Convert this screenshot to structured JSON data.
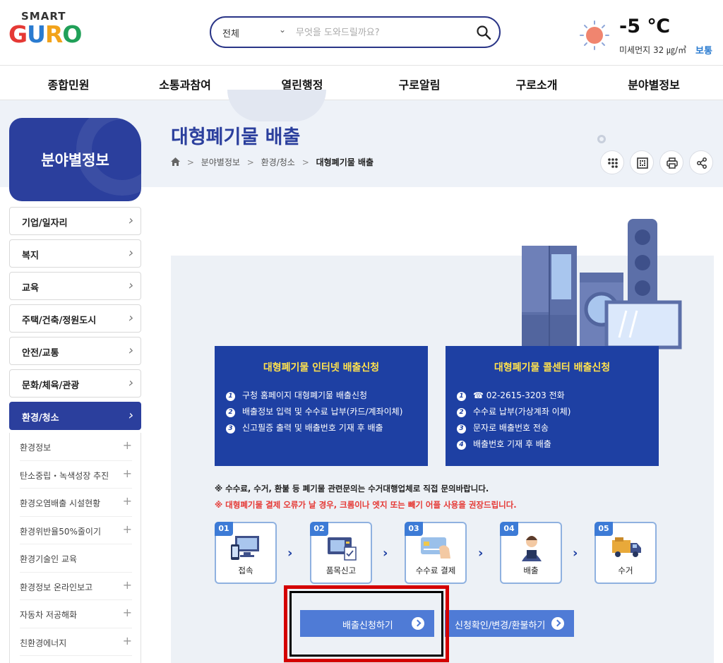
{
  "header": {
    "logo_top": "SMART",
    "logo_bottom": "GURO",
    "search_scope": "전체",
    "search_placeholder": "무엇을 도와드릴까요?",
    "temperature": "-5 ℃",
    "dust_text": "미세먼지 32 ㎍/㎥",
    "dust_status": "보통"
  },
  "gnb": [
    "종합민원",
    "소통과참여",
    "열린행정",
    "구로알림",
    "구로소개",
    "분야별정보"
  ],
  "sidebar": {
    "title": "분야별정보",
    "items": [
      {
        "label": "기업/일자리"
      },
      {
        "label": "복지"
      },
      {
        "label": "교육"
      },
      {
        "label": "주택/건축/정원도시"
      },
      {
        "label": "안전/교통"
      },
      {
        "label": "문화/체육/관광"
      },
      {
        "label": "환경/청소"
      }
    ],
    "subitems": [
      {
        "label": "환경정보",
        "plus": "+"
      },
      {
        "label": "탄소중립・녹색성장 추진",
        "plus": "+"
      },
      {
        "label": "환경오염배출 시설현황",
        "plus": "+"
      },
      {
        "label": "환경위반율50%줄이기",
        "plus": "+"
      },
      {
        "label": "환경기술인 교육",
        "plus": ""
      },
      {
        "label": "환경정보 온라인보고",
        "plus": "+"
      },
      {
        "label": "자동차 저공해화",
        "plus": "+"
      },
      {
        "label": "친환경에너지",
        "plus": "+"
      }
    ]
  },
  "page": {
    "title": "대형폐기물 배출",
    "breadcrumb": [
      "분야별정보",
      "환경/청소",
      "대형폐기물 배출"
    ]
  },
  "info": {
    "internet": {
      "title": "대형폐기물 인터넷 배출신청",
      "steps": [
        "구청 홈페이지 대형폐기물 배출신청",
        "배출정보 입력 및 수수료 납부(카드/계좌이체)",
        "신고필증 출력 및 배출번호 기재 후 배출"
      ]
    },
    "callcenter": {
      "title": "대형폐기물 콜센터 배출신청",
      "steps": [
        "☎ 02-2615-3203 전화",
        "수수료 납부(가상계좌 이체)",
        "문자로 배출번호 전송",
        "배출번호 기재 후 배출"
      ]
    },
    "notice1": "※ 수수료, 수거, 환불 등 폐기물 관련문의는 수거대행업체로 직접 문의바랍니다.",
    "notice2": "※ 대형폐기물 결제 오류가 날 경우, 크롬이나 엣지 또는 빼기 어플 사용을 권장드립니다.",
    "process": [
      {
        "num": "01",
        "label": "접속"
      },
      {
        "num": "02",
        "label": "품목신고"
      },
      {
        "num": "03",
        "label": "수수료 결제"
      },
      {
        "num": "04",
        "label": "배출"
      },
      {
        "num": "05",
        "label": "수거"
      }
    ],
    "apply_button": "배출신청하기",
    "check_button": "신청확인/변경/환불하기"
  },
  "colors": {
    "brand_navy": "#2b3f9d",
    "box_blue": "#1e40a3",
    "button_blue": "#4f7bd6",
    "notice_red": "#e53935",
    "highlight_red": "#d40000"
  }
}
